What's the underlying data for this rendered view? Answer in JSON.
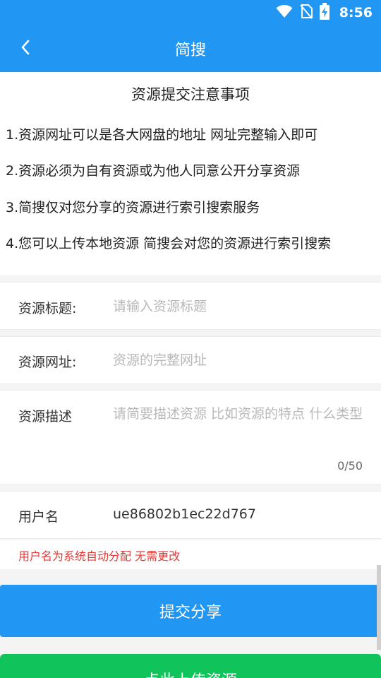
{
  "status_bar": {
    "time": "8:56"
  },
  "app_bar": {
    "title": "简搜"
  },
  "notice": {
    "title": "资源提交注意事项",
    "items": [
      "1.资源网址可以是各大网盘的地址 网址完整输入即可",
      "2.资源必须为自有资源或为他人同意公开分享资源",
      "3.简搜仅对您分享的资源进行索引搜索服务",
      "4.您可以上传本地资源 简搜会对您的资源进行索引搜索"
    ]
  },
  "form": {
    "title_label": "资源标题:",
    "title_placeholder": "请输入资源标题",
    "url_label": "资源网址:",
    "url_placeholder": "资源的完整网址",
    "desc_label": "资源描述",
    "desc_placeholder": "请简要描述资源 比如资源的特点 什么类型",
    "desc_counter": "0/50",
    "username_label": "用户名",
    "username_value": "ue86802b1ec22d767",
    "hint": "用户名为系统自动分配 无需更改"
  },
  "buttons": {
    "submit": "提交分享",
    "upload": "点此上传资源"
  },
  "colors": {
    "primary": "#2196f3",
    "upload": "#10c35b",
    "hint": "#e53935"
  },
  "icons": {
    "back": "chevron-left-icon",
    "wifi": "wifi-icon",
    "no_sim": "no-sim-icon",
    "battery": "battery-charging-icon"
  }
}
